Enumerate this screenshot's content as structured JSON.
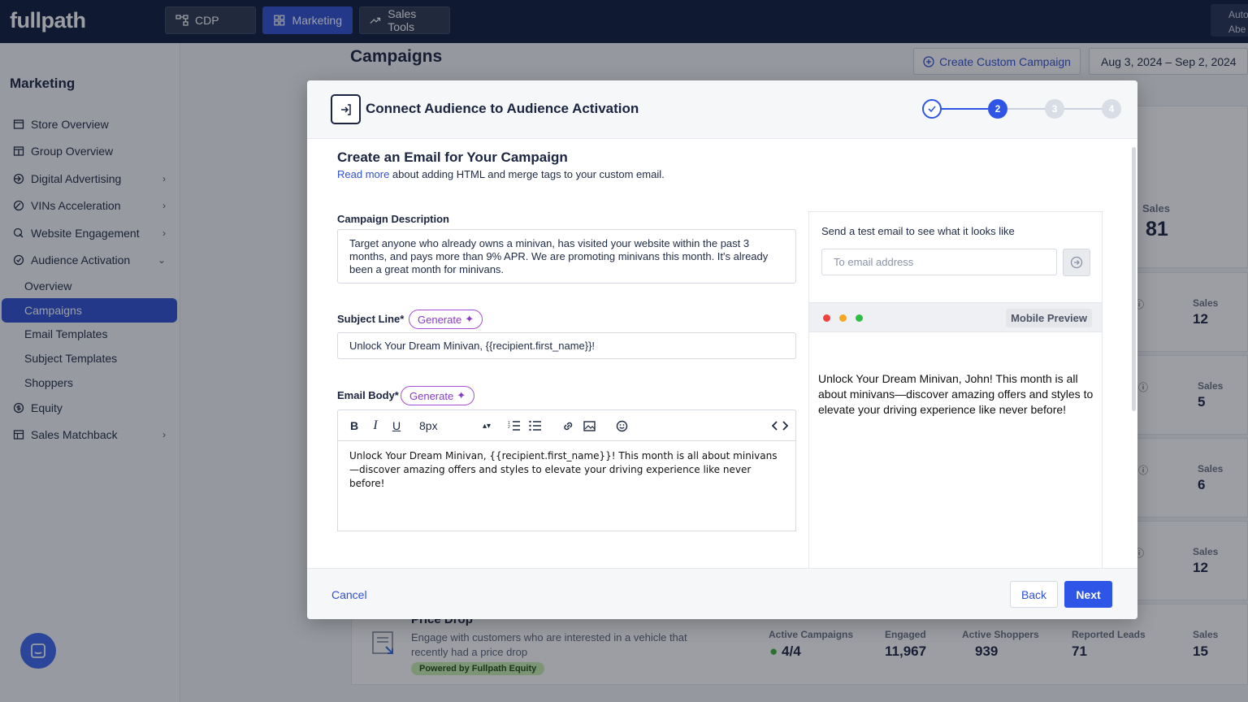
{
  "topbar": {
    "logo": "fullpath",
    "nav": [
      {
        "label": "CDP",
        "icon": "cdp-icon"
      },
      {
        "label": "Marketing",
        "icon": "grid-icon"
      },
      {
        "label": "Sales Tools",
        "icon": "trend-icon"
      }
    ],
    "account": {
      "line1": "Auto",
      "line2": "Abe"
    }
  },
  "sidebar": {
    "title": "Marketing",
    "items": [
      {
        "label": "Store Overview"
      },
      {
        "label": "Group Overview"
      },
      {
        "label": "Digital Advertising"
      },
      {
        "label": "VINs Acceleration"
      },
      {
        "label": "Website Engagement"
      },
      {
        "label": "Audience Activation"
      }
    ],
    "sub_items": [
      "Overview",
      "Campaigns",
      "Email Templates",
      "Subject Templates",
      "Shoppers"
    ],
    "items_after": [
      {
        "label": "Equity"
      },
      {
        "label": "Sales Matchback"
      }
    ]
  },
  "main": {
    "title": "Campaigns",
    "create_button": "Create Custom Campaign",
    "date_range": "Aug 3, 2024 – Sep 2, 2024",
    "summary": {
      "label": "Sales",
      "value": "81"
    },
    "rows": [
      {
        "sales_label": "Sales",
        "sales": "12"
      },
      {
        "sales_label": "Sales",
        "sales": "5"
      },
      {
        "sales_label": "Sales",
        "sales": "6"
      },
      {
        "sales_label": "Sales",
        "sales": "12"
      }
    ],
    "last_row": {
      "title": "Price Drop",
      "desc1": "Engage with customers who are interested in a vehicle that",
      "desc2": "recently had a price drop",
      "badge": "Powered by Fullpath Equity",
      "active_campaigns_label": "Active Campaigns",
      "active_campaigns": "4/4",
      "engaged_label": "Engaged",
      "engaged": "11,967",
      "active_shoppers_label": "Active Shoppers",
      "active_shoppers": "939",
      "reported_leads_label": "Reported Leads",
      "reported_leads": "71",
      "sales_label": "Sales",
      "sales": "15"
    }
  },
  "modal": {
    "title": "Connect Audience to Audience Activation",
    "steps": [
      "2",
      "3",
      "4"
    ],
    "section_title": "Create an Email for Your Campaign",
    "read_more": "Read more",
    "section_sub": " about adding HTML and merge tags to your custom email.",
    "description_label": "Campaign Description",
    "description": "Target anyone who already owns a minivan, has visited your website within the past 3 months, and pays more than 9% APR. We are promoting minivans this month. It's already been a great month for minivans.",
    "subject_label": "Subject Line*",
    "generate": "Generate",
    "subject_value": "Unlock Your Dream Minivan, {{recipient.first_name}}!",
    "body_label": "Email Body*",
    "font_size": "8px",
    "body_text": "Unlock Your Dream Minivan, {{recipient.first_name}}! This month is all about minivans—discover amazing offers and styles to elevate your driving experience like never before!",
    "test_label": "Send a test email to see what it looks like",
    "test_placeholder": "To email address",
    "mobile_preview": "Mobile Preview",
    "preview_text": "Unlock Your Dream Minivan, John! This month is all about minivans—discover amazing offers and styles to elevate your driving experience like never before!",
    "cancel": "Cancel",
    "back": "Back",
    "next": "Next"
  },
  "colors": {
    "accent": "#3150d3",
    "navy": "#0e1b3d",
    "generate": "#a64fd6"
  }
}
